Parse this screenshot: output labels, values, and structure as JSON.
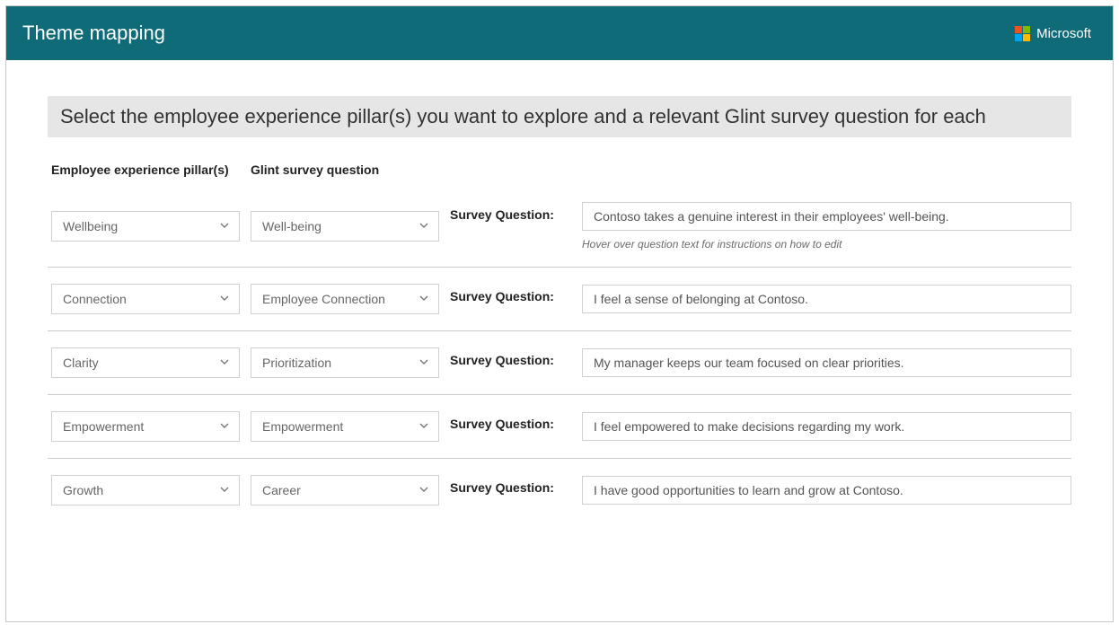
{
  "header": {
    "title": "Theme mapping",
    "brand": "Microsoft"
  },
  "instruction": "Select the employee experience pillar(s) you want to explore and a relevant Glint survey question for each",
  "columns": {
    "pillar": "Employee experience pillar(s)",
    "glint": "Glint survey question"
  },
  "sq_label": "Survey Question:",
  "helper": "Hover over question text for instructions on how to edit",
  "rows": [
    {
      "pillar": "Wellbeing",
      "glint": "Well-being",
      "question": "Contoso takes a genuine interest in their employees' well-being.",
      "show_helper": true
    },
    {
      "pillar": "Connection",
      "glint": "Employee Connection",
      "question": "I feel a sense of belonging at Contoso.",
      "show_helper": false
    },
    {
      "pillar": "Clarity",
      "glint": "Prioritization",
      "question": "My manager keeps our team focused on clear priorities.",
      "show_helper": false
    },
    {
      "pillar": "Empowerment",
      "glint": "Empowerment",
      "question": "I feel empowered to make decisions regarding my work.",
      "show_helper": false
    },
    {
      "pillar": "Growth",
      "glint": "Career",
      "question": "I have good opportunities to learn and grow at Contoso.",
      "show_helper": false
    }
  ]
}
